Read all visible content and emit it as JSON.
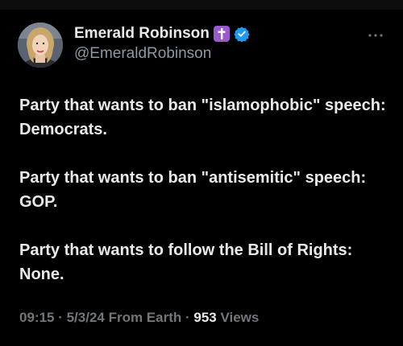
{
  "author": {
    "display_name": "Emerald Robinson",
    "handle": "@EmeraldRobinson",
    "badges": [
      "cross-icon",
      "verified-icon"
    ],
    "avatar": "avatar-photo"
  },
  "post": {
    "paragraphs": [
      "Party that wants to ban \"islamophobic\" speech: Democrats.",
      "Party that wants to ban \"antisemitic\" speech: GOP.",
      "Party that wants to follow the Bill of Rights: None."
    ]
  },
  "meta": {
    "time": "09:15",
    "separator1": " · ",
    "date": "5/3/24",
    "source": " From Earth",
    "separator2": " · ",
    "views_count": "953",
    "views_label": " Views"
  },
  "colors": {
    "background": "#000000",
    "text": "#e7e9ea",
    "secondary": "#71767b",
    "verified": "#1d9bf0",
    "cross_badge": "#9b59d0"
  },
  "icons": {
    "more": "more-horizontal-icon"
  }
}
